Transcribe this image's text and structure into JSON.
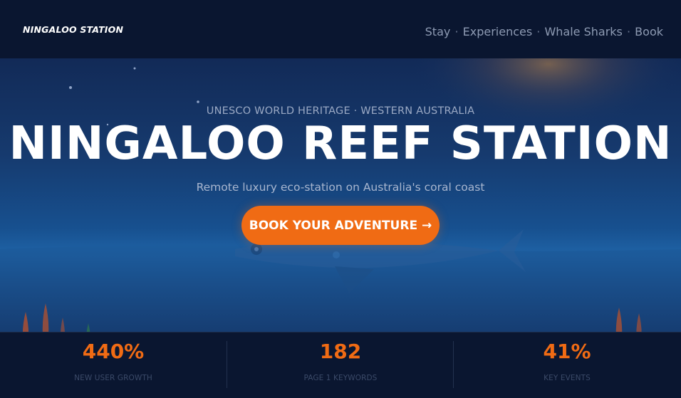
{
  "header": {
    "logo": "NINGALOO STATION",
    "nav": [
      "Stay",
      "Experiences",
      "Whale Sharks",
      "Book"
    ],
    "nav_separator": "·"
  },
  "hero": {
    "eyebrow": "UNESCO WORLD HERITAGE · WESTERN AUSTRALIA",
    "title": "NINGALOO REEF STATION",
    "subtitle": "Remote luxury eco-station on Australia's coral coast",
    "cta_label": "BOOK YOUR ADVENTURE →"
  },
  "stats": [
    {
      "value": "440%",
      "label": "NEW USER GROWTH"
    },
    {
      "value": "182",
      "label": "PAGE 1 KEYWORDS"
    },
    {
      "value": "41%",
      "label": "KEY EVENTS"
    }
  ],
  "colors": {
    "accent": "#f06b14",
    "background": "#0a1630",
    "sky_top": "#122a57",
    "sea": "#1f63a6"
  }
}
